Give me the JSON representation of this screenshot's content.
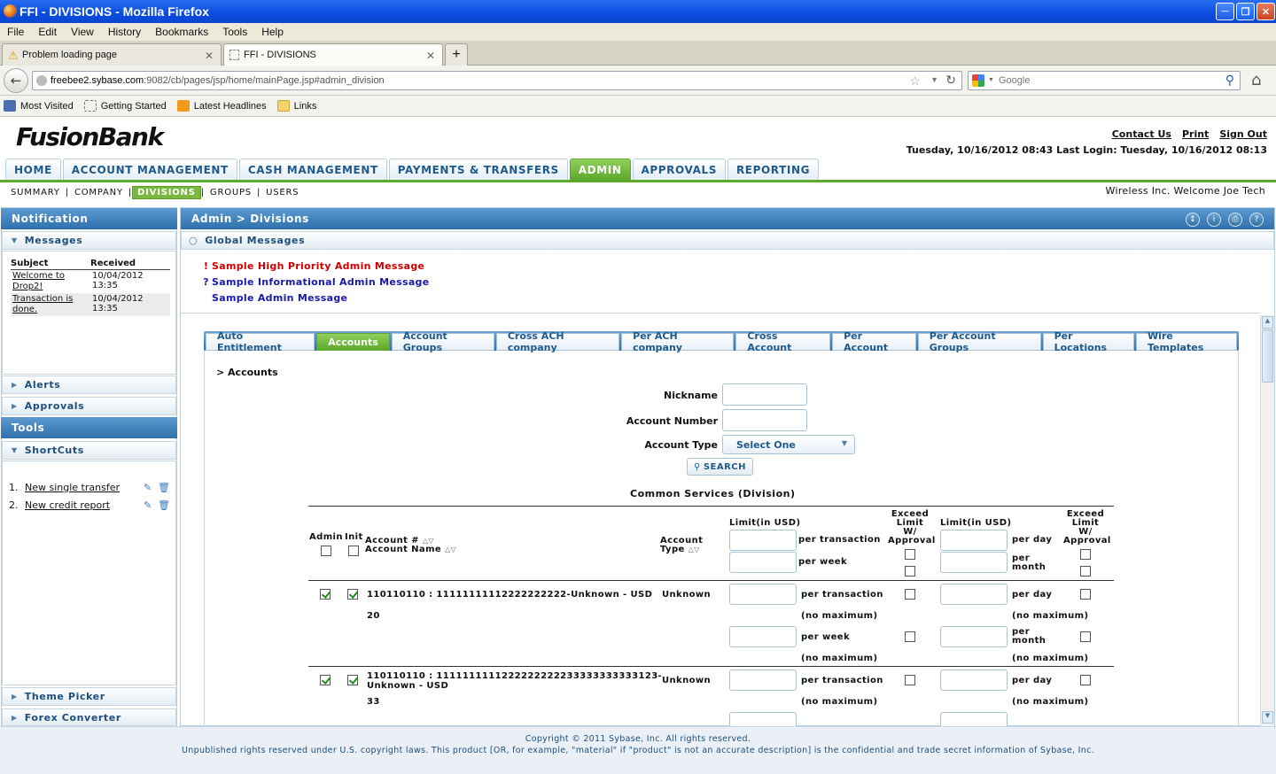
{
  "window": {
    "title": "FFI - DIVISIONS - Mozilla Firefox"
  },
  "menu": [
    "File",
    "Edit",
    "View",
    "History",
    "Bookmarks",
    "Tools",
    "Help"
  ],
  "tabs": [
    {
      "label": "Problem loading page"
    },
    {
      "label": "FFI - DIVISIONS"
    }
  ],
  "url": {
    "host": "freebee2.sybase.com",
    "rest": ":9082/cb/pages/jsp/home/mainPage.jsp#admin_division"
  },
  "search": {
    "placeholder": "Google"
  },
  "bookmarks": [
    "Most Visited",
    "Getting Started",
    "Latest Headlines",
    "Links"
  ],
  "brand": {
    "logo": "FusionBank"
  },
  "toplinks": [
    "Contact Us",
    "Print",
    "Sign Out"
  ],
  "datetime": "Tuesday, 10/16/2012 08:43 Last Login: Tuesday, 10/16/2012 08:13",
  "mainnav": [
    {
      "label": "HOME"
    },
    {
      "label": "ACCOUNT MANAGEMENT"
    },
    {
      "label": "CASH MANAGEMENT"
    },
    {
      "label": "PAYMENTS & TRANSFERS"
    },
    {
      "label": "ADMIN"
    },
    {
      "label": "APPROVALS"
    },
    {
      "label": "REPORTING"
    }
  ],
  "subnav": [
    "SUMMARY",
    "COMPANY",
    "DIVISIONS",
    "GROUPS",
    "USERS"
  ],
  "welcome": "Wireless Inc. Welcome Joe Tech",
  "left": {
    "notification": "Notification",
    "messages": "Messages",
    "msg_cols": [
      "Subject",
      "Received"
    ],
    "msg_rows": [
      {
        "subject1": "Welcome to",
        "subject2": "Drop2!",
        "date": "10/04/2012",
        "time": "13:35"
      },
      {
        "subject1": "Transaction is",
        "subject2": "done.",
        "date": "10/04/2012",
        "time": "13:35"
      }
    ],
    "alerts": "Alerts",
    "approvals": "Approvals",
    "tools": "Tools",
    "shortcuts": "ShortCuts",
    "shortcut_items": [
      {
        "num": "1.",
        "label": "New single transfer"
      },
      {
        "num": "2.",
        "label": "New credit report"
      }
    ],
    "theme_picker": "Theme Picker",
    "forex": "Forex Converter"
  },
  "main": {
    "breadcrumb": "Admin > Divisions",
    "global_messages": "Global Messages",
    "messages": [
      {
        "icon": "!",
        "text": "Sample High Priority Admin Message",
        "color": "#cc0000"
      },
      {
        "icon": "?",
        "text": "Sample Informational Admin Message",
        "color": "#1a1aa6"
      },
      {
        "icon": "",
        "text": "Sample Admin Message",
        "color": "#1a1aa6"
      }
    ],
    "tabs": [
      "Auto Entitlement",
      "Accounts",
      "Account Groups",
      "Cross ACH company",
      "Per ACH company",
      "Cross Account",
      "Per Account",
      "Per Account Groups",
      "Per Locations",
      "Wire Templates"
    ],
    "section": "> Accounts",
    "form": {
      "nickname": "Nickname",
      "account_number": "Account Number",
      "account_type": "Account Type",
      "select_value": "Select One",
      "search": "SEARCH"
    },
    "table_title": "Common Services (Division)",
    "headers": {
      "admin": "Admin",
      "init": "Init",
      "acct_num": "Account #",
      "acct_name": "Account Name",
      "acct_type1": "Account",
      "acct_type2": "Type",
      "limit": "Limit(in USD)",
      "per_transaction": "per transaction",
      "per_week": "per week",
      "exceed1": "Exceed",
      "exceed2": "Limit",
      "exceed3": "W/",
      "exceed4": "Approval",
      "per_day": "per day",
      "per": "per",
      "month": "month"
    },
    "rows": [
      {
        "account": "110110110 : 11111111112222222222-Unknown - USD",
        "account2": "",
        "extra": "20",
        "type": "Unknown",
        "no_max": "(no maximum)"
      },
      {
        "account": "110110110 : 1111111111222222222233333333333123-",
        "account2": "Unknown - USD",
        "extra": "33",
        "type": "Unknown",
        "no_max": "(no maximum)"
      }
    ]
  },
  "footer": {
    "line1": "Copyright © 2011 Sybase, Inc. All rights reserved.",
    "line2": "Unpublished rights reserved under U.S. copyright laws. This product [OR, for example, \"material\" if \"product\" is not an accurate description] is the confidential and trade secret information of Sybase, Inc."
  }
}
